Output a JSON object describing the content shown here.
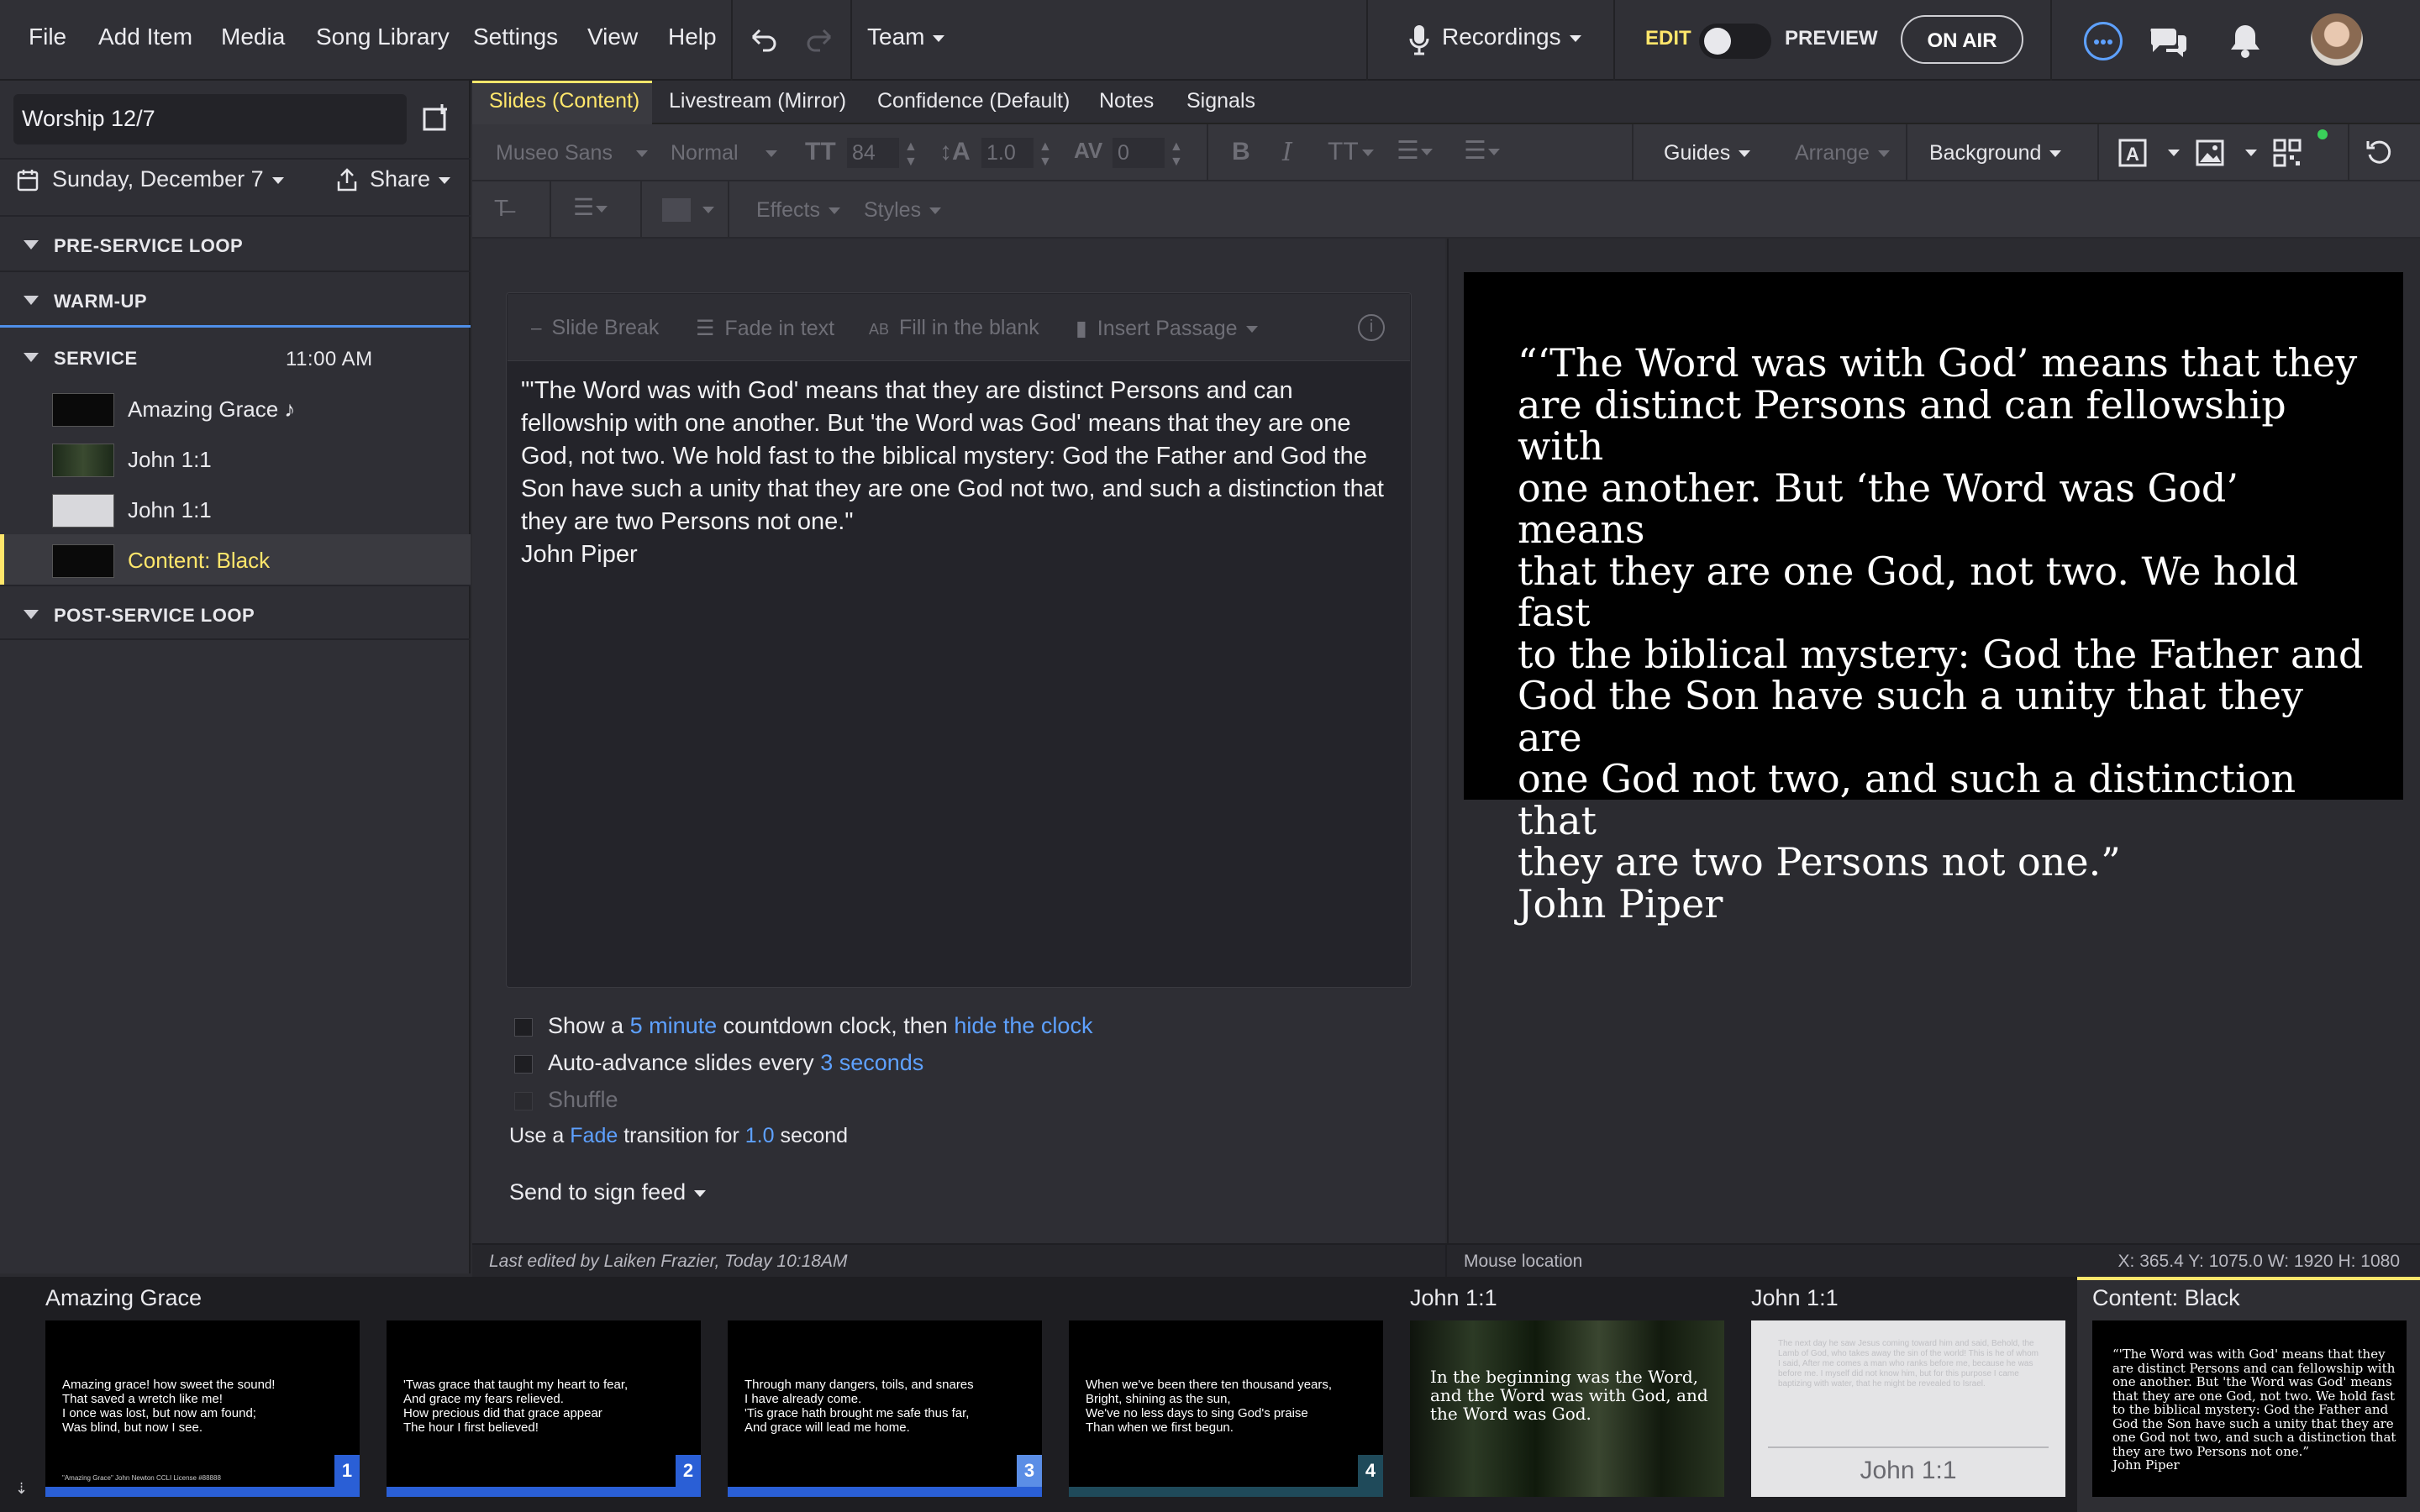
{
  "menubar": {
    "items": [
      "File",
      "Add Item",
      "Media",
      "Song Library",
      "Settings",
      "View",
      "Help"
    ],
    "team_label": "Team",
    "recordings_label": "Recordings",
    "edit_label": "EDIT",
    "preview_label": "PREVIEW",
    "on_air_label": "ON AIR"
  },
  "plan": {
    "title": "Worship 12/7",
    "date": "Sunday, December 7",
    "share_label": "Share"
  },
  "sections": [
    {
      "label": "PRE-SERVICE LOOP"
    },
    {
      "label": "WARM-UP"
    },
    {
      "label": "SERVICE",
      "time": "11:00 AM"
    },
    {
      "label": "POST-SERVICE LOOP"
    }
  ],
  "service_items": [
    {
      "label": "Amazing Grace ♪"
    },
    {
      "label": "John 1:1"
    },
    {
      "label": "John 1:1"
    },
    {
      "label": "Content: Black"
    }
  ],
  "tabs": [
    "Slides (Content)",
    "Livestream (Mirror)",
    "Confidence (Default)",
    "Notes",
    "Signals"
  ],
  "toolbar": {
    "font": "Museo Sans",
    "weight": "Normal",
    "size": "84",
    "line_height": "1.0",
    "tracking": "0",
    "guides": "Guides",
    "arrange": "Arrange",
    "background": "Background",
    "effects": "Effects",
    "styles": "Styles"
  },
  "editor_tools": {
    "slide_break": "Slide Break",
    "fade_in_text": "Fade in text",
    "fill_in_blank": "Fill in the blank",
    "insert_passage": "Insert Passage"
  },
  "editor_text": "\"'The Word was with God' means that they are distinct Persons and can\nfellowship with one another. But 'the Word was God' means that they are one\nGod, not two. We hold fast to the biblical mystery: God the Father and God the\nSon have such a unity that they are one God not two, and such a distinction that\nthey are two Persons not one.\"\nJohn Piper",
  "options": {
    "countdown_pre": "Show a",
    "countdown_link": "5 minute",
    "countdown_mid": "countdown clock, then",
    "countdown_link2": "hide the clock",
    "advance_pre": "Auto-advance slides every",
    "advance_link": "3 seconds",
    "shuffle": "Shuffle",
    "transition_pre": "Use a",
    "transition_link": "Fade",
    "transition_mid": "transition  for",
    "transition_link2": "1.0",
    "transition_post": "second",
    "sign_feed": "Send to sign feed"
  },
  "preview_text": "“‘The Word was with God’ means that they\nare distinct Persons and can fellowship with\none another. But ‘the Word was God’ means\nthat they are one God, not two. We hold fast\nto the biblical mystery: God the Father and\nGod the Son have such a unity that they are\none God not two, and such a distinction that\nthey are two Persons not one.”\nJohn Piper",
  "status": {
    "last_edited": "Last edited by Laiken Frazier, Today 10:18AM",
    "mouse_label": "Mouse location",
    "coords": "X: 365.4  Y: 1075.0    W: 1920  H: 1080"
  },
  "bottom": {
    "group1": "Amazing Grace",
    "group2": "John 1:1",
    "group3": "John 1:1",
    "group4": "Content: Black",
    "slides": [
      {
        "text": "Amazing grace! how sweet the sound!\nThat saved a wretch like me!\nI once was lost, but now am found;\nWas blind, but now I see.",
        "num": "1",
        "footer": "\"Amazing Grace\" John Newton CCLI License #88888"
      },
      {
        "text": "'Twas grace that taught my heart to fear,\nAnd grace my fears relieved.\nHow precious did that grace appear\nThe hour I first believed!",
        "num": "2"
      },
      {
        "text": "Through many dangers, toils, and snares\nI have already come.\n'Tis grace hath brought me safe thus far,\nAnd grace will lead me home.",
        "num": "3"
      },
      {
        "text": "When we've been there ten thousand years,\nBright, shining as the sun,\nWe've no less days to sing God's praise\nThan when we first begun.",
        "num": "4"
      }
    ],
    "john_dark": "In the beginning was the Word,\nand the Word was with God, and\nthe Word was God.",
    "john_light_ref": "John 1:1",
    "john_light_body": "The next day he saw Jesus coming toward him and said, Behold, the Lamb of God, who takes away the sin of the world! This is he of whom I said, After me comes a man who ranks before me, because he was before me. I myself did not know him, but for this purpose I came baptizing with water, that he might be revealed to Israel.",
    "black_text": "“'The Word was with God' means that they\nare distinct Persons and can fellowship with\none another. But 'the Word was God' means\nthat they are one God, not two. We hold fast\nto the biblical mystery: God the Father and\nGod the Son have such a unity that they are\none God not two, and such a distinction that\nthey are two Persons not one.”\nJohn Piper"
  },
  "colors": {
    "accent": "#ffe66b",
    "link": "#5ea1ff",
    "slide_number": "#2a5fd6"
  }
}
